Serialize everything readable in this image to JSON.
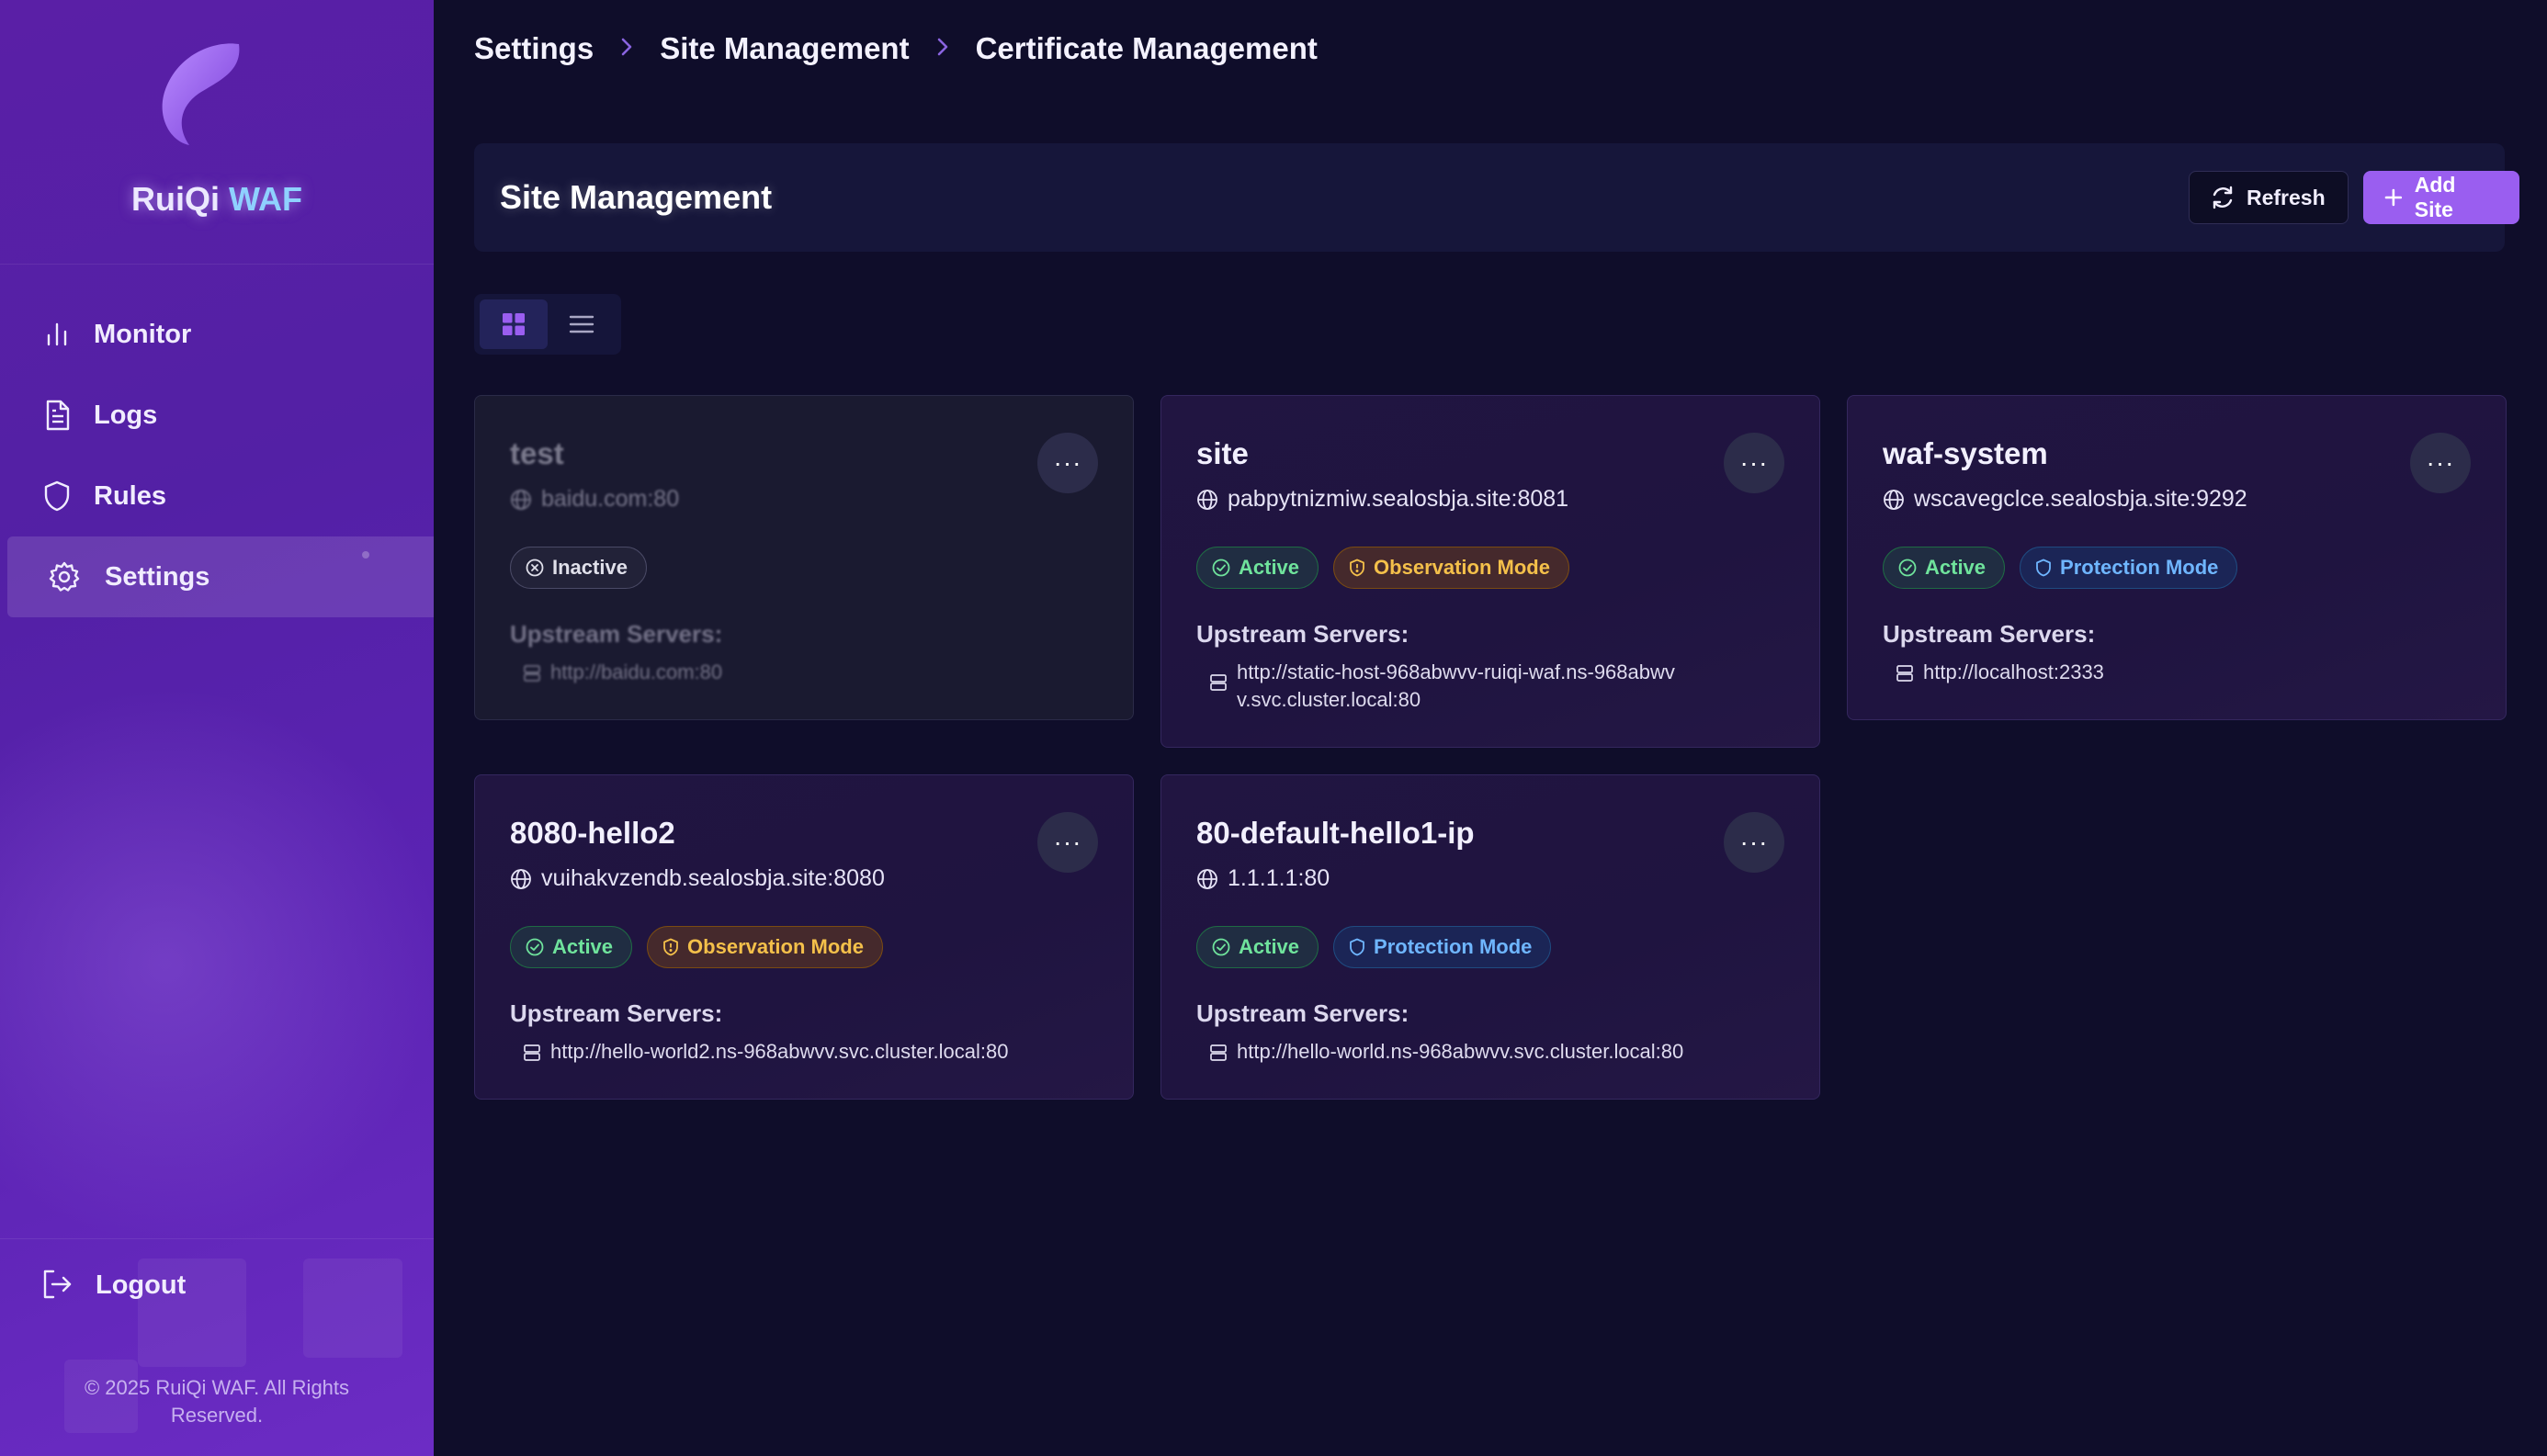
{
  "app": {
    "brand_primary": "RuiQi",
    "brand_accent": "WAF",
    "copyright": "© 2025 RuiQi WAF. All Rights Reserved."
  },
  "sidebar": {
    "items": [
      {
        "label": "Monitor",
        "icon": "bar-chart-icon"
      },
      {
        "label": "Logs",
        "icon": "document-icon"
      },
      {
        "label": "Rules",
        "icon": "shield-icon"
      },
      {
        "label": "Settings",
        "icon": "gear-icon",
        "active": true
      }
    ],
    "logout_label": "Logout"
  },
  "breadcrumb": [
    "Settings",
    "Site Management",
    "Certificate Management"
  ],
  "header": {
    "title": "Site Management",
    "refresh_label": "Refresh",
    "add_label": "Add Site"
  },
  "colors": {
    "accent": "#9a5ef0",
    "active": "#6fe39c",
    "observation": "#f4c04a",
    "protection": "#6fb6ff"
  },
  "sites": [
    {
      "name": "test",
      "domain": "baidu.com:80",
      "status": "Inactive",
      "upstream_label": "Upstream Servers:",
      "upstreams": [
        "http://baidu.com:80"
      ]
    },
    {
      "name": "site",
      "domain": "pabpytnizmiw.sealosbja.site:8081",
      "status": "Active",
      "mode": "Observation Mode",
      "upstream_label": "Upstream Servers:",
      "upstreams": [
        "http://static-host-968abwvv-ruiqi-waf.ns-968abwvv.svc.cluster.local:80"
      ]
    },
    {
      "name": "waf-system",
      "domain": "wscavegclce.sealosbja.site:9292",
      "status": "Active",
      "mode": "Protection Mode",
      "upstream_label": "Upstream Servers:",
      "upstreams": [
        "http://localhost:2333"
      ]
    },
    {
      "name": "8080-hello2",
      "domain": "vuihakvzendb.sealosbja.site:8080",
      "status": "Active",
      "mode": "Observation Mode",
      "upstream_label": "Upstream Servers:",
      "upstreams": [
        "http://hello-world2.ns-968abwvv.svc.cluster.local:80"
      ]
    },
    {
      "name": "80-default-hello1-ip",
      "domain": "1.1.1.1:80",
      "status": "Active",
      "mode": "Protection Mode",
      "upstream_label": "Upstream Servers:",
      "upstreams": [
        "http://hello-world.ns-968abwvv.svc.cluster.local:80"
      ]
    }
  ]
}
